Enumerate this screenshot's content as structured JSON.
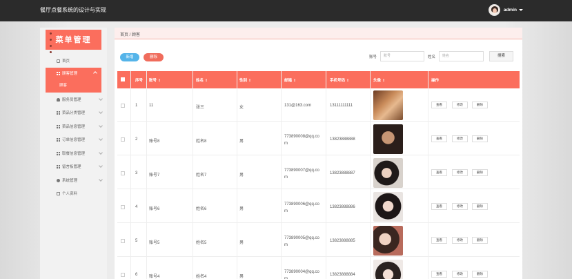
{
  "app": {
    "title": "餐厅点餐系统的设计与实现",
    "username": "admin"
  },
  "sidebar": {
    "logo_text": "菜单管理",
    "items": [
      {
        "label": "首页",
        "icon": "home-icon"
      },
      {
        "label": "顾客管理",
        "icon": "grid-icon",
        "active": true,
        "sub": "顾客"
      },
      {
        "label": "服务员管理",
        "icon": "user-icon"
      },
      {
        "label": "菜品分类管理",
        "icon": "grid-icon"
      },
      {
        "label": "菜品信息管理",
        "icon": "grid-icon"
      },
      {
        "label": "订单信息管理",
        "icon": "grid-icon"
      },
      {
        "label": "取餐信息管理",
        "icon": "grid-icon"
      },
      {
        "label": "留言板管理",
        "icon": "grid-icon"
      },
      {
        "label": "系统管理",
        "icon": "gear-icon"
      },
      {
        "label": "个人资料",
        "icon": "card-icon"
      }
    ]
  },
  "breadcrumb": "首页 / 顾客",
  "toolbar": {
    "add_label": "新增",
    "delete_label": "删除"
  },
  "search": {
    "account_label": "账号",
    "account_placeholder": "账号",
    "name_label": "姓名",
    "name_placeholder": "姓名",
    "button": "搜索"
  },
  "table": {
    "headers": [
      "序号",
      "账号",
      "姓名",
      "性别",
      "邮箱",
      "手机号码",
      "头像",
      "操作"
    ],
    "sortable": [
      "⇕",
      "⇕",
      "⇕",
      "⇕",
      "⇕",
      "⇕",
      "⇕"
    ],
    "rows": [
      {
        "idx": "1",
        "account": "11",
        "name": "张三",
        "gender": "女",
        "email1": "131@163.com",
        "email2": "",
        "phone": "13111111111"
      },
      {
        "idx": "2",
        "account": "账号8",
        "name": "姓名8",
        "gender": "男",
        "email1": "773890008@qq.co",
        "email2": "m",
        "phone": "13823888888"
      },
      {
        "idx": "3",
        "account": "账号7",
        "name": "姓名7",
        "gender": "男",
        "email1": "773890007@qq.co",
        "email2": "m",
        "phone": "13823888887"
      },
      {
        "idx": "4",
        "account": "账号6",
        "name": "姓名6",
        "gender": "男",
        "email1": "773890006@qq.co",
        "email2": "m",
        "phone": "13823888886"
      },
      {
        "idx": "5",
        "account": "账号5",
        "name": "姓名5",
        "gender": "男",
        "email1": "773890005@qq.co",
        "email2": "m",
        "phone": "13823888885"
      },
      {
        "idx": "6",
        "account": "账号4",
        "name": "姓名4",
        "gender": "男",
        "email1": "773890004@qq.co",
        "email2": "m",
        "phone": "13823888884"
      }
    ],
    "actions": {
      "view": "查看",
      "edit": "修改",
      "delete": "删除"
    }
  },
  "colors": {
    "accent": "#fb6e5d",
    "topbar": "#2b2b2b",
    "blue": "#55b4e9"
  }
}
